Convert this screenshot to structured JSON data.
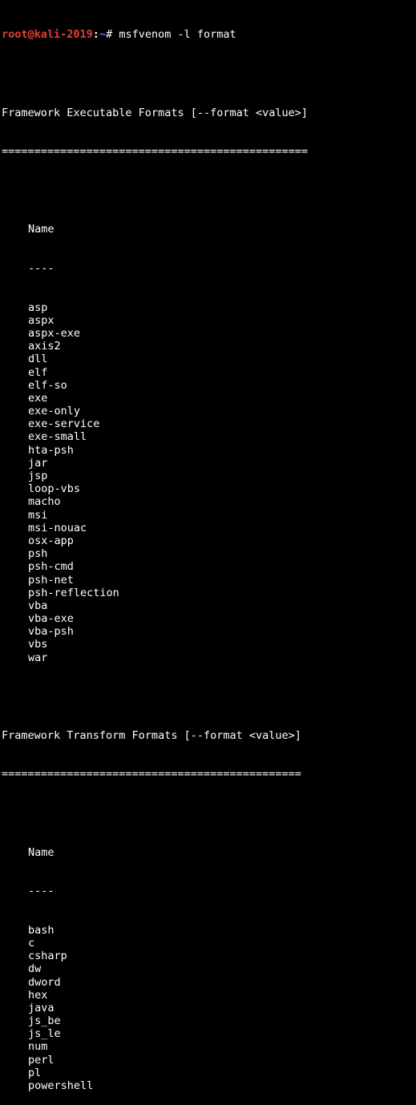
{
  "prompt": {
    "user_host": "root@kali-2019",
    "separator": ":",
    "path": "~",
    "symbol": "#",
    "command": " msfvenom -l format"
  },
  "colors": {
    "background": "#000000",
    "foreground": "#ffffff",
    "prompt_user": "#e0403a",
    "prompt_path": "#4f7ef0"
  },
  "executable_section": {
    "title": "Framework Executable Formats [--format <value>]",
    "underline": "===============================================",
    "header": "Name",
    "header_rule": "----",
    "items": [
      "asp",
      "aspx",
      "aspx-exe",
      "axis2",
      "dll",
      "elf",
      "elf-so",
      "exe",
      "exe-only",
      "exe-service",
      "exe-small",
      "hta-psh",
      "jar",
      "jsp",
      "loop-vbs",
      "macho",
      "msi",
      "msi-nouac",
      "osx-app",
      "psh",
      "psh-cmd",
      "psh-net",
      "psh-reflection",
      "vba",
      "vba-exe",
      "vba-psh",
      "vbs",
      "war"
    ]
  },
  "transform_section": {
    "title": "Framework Transform Formats [--format <value>]",
    "underline": "==============================================",
    "header": "Name",
    "header_rule": "----",
    "items": [
      "bash",
      "c",
      "csharp",
      "dw",
      "dword",
      "hex",
      "java",
      "js_be",
      "js_le",
      "num",
      "perl",
      "pl",
      "powershell"
    ]
  }
}
